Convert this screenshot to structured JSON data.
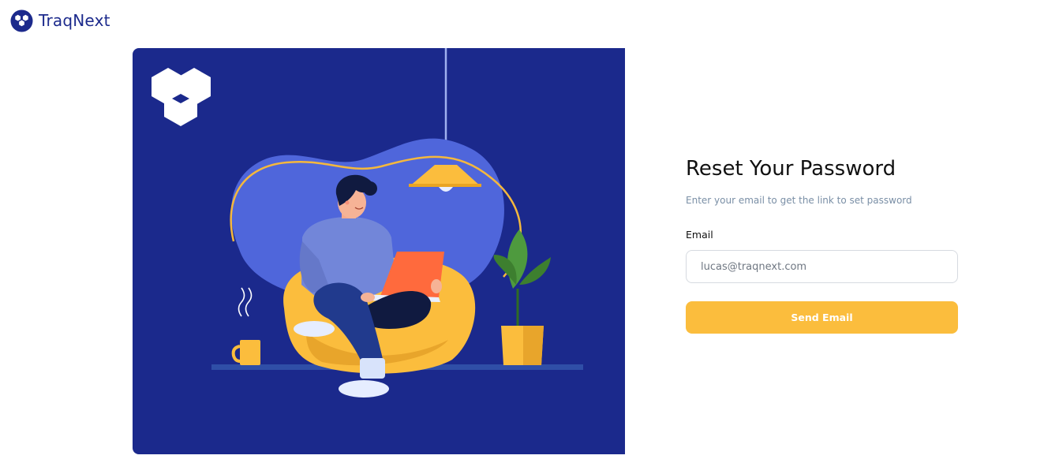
{
  "brand": {
    "name": "TraqNext",
    "icon": "traqnext-logo-icon"
  },
  "hero": {
    "illustration": "person-with-laptop-on-beanbag",
    "background_color": "#1b298c"
  },
  "form": {
    "title": "Reset Your Password",
    "subtitle": "Enter your email to get the link to set password",
    "email_label": "Email",
    "email_value": "lucas@traqnext.com",
    "submit_label": "Send Email"
  },
  "colors": {
    "brand": "#1c2a8c",
    "accent": "#fbbd3d",
    "muted_text": "#7a8fa6"
  }
}
